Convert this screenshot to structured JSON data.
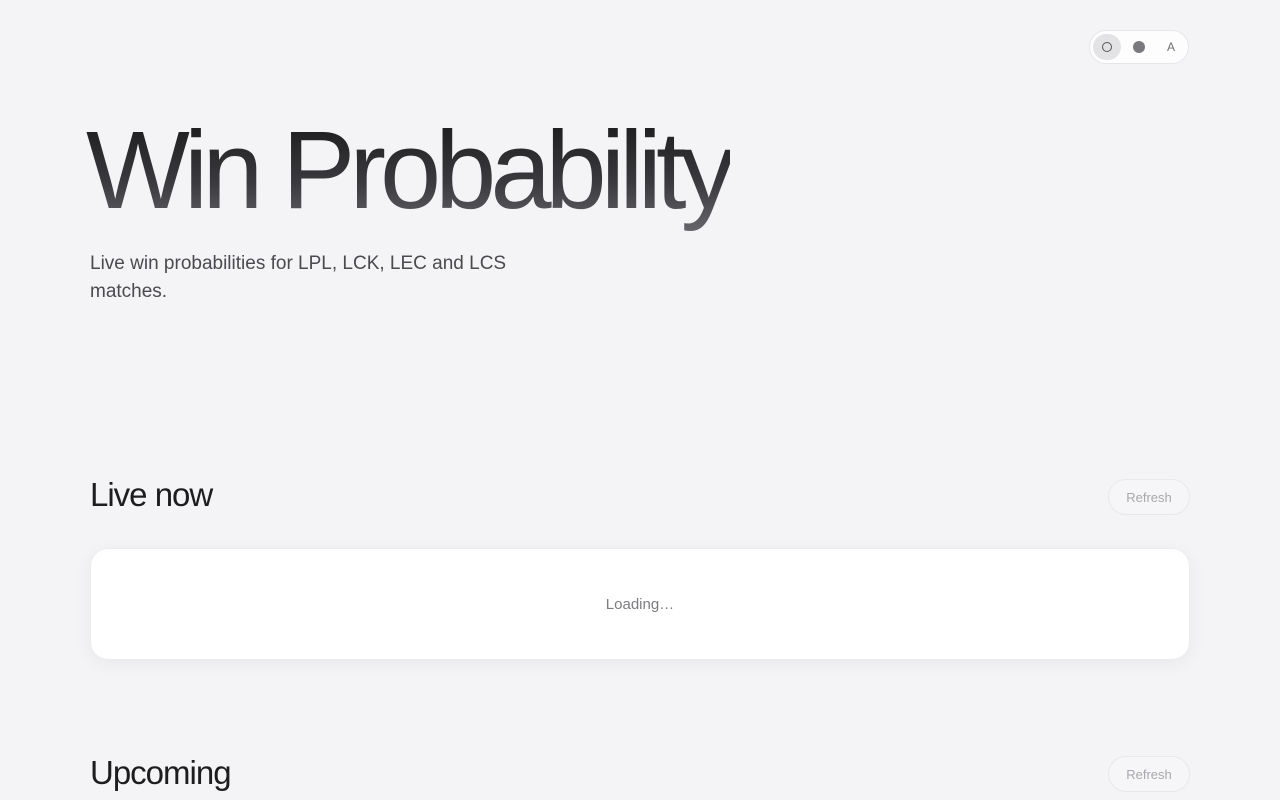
{
  "theme_toggle": {
    "options": [
      {
        "icon": "light-mode-icon",
        "active": true
      },
      {
        "icon": "dark-mode-icon",
        "active": false
      },
      {
        "icon": "auto-mode-icon",
        "label": "A",
        "active": false
      }
    ]
  },
  "hero": {
    "title": "Win Probability",
    "subtitle": "Live win probabilities for LPL, LCK, LEC and LCS matches."
  },
  "live_section": {
    "title": "Live now",
    "refresh_label": "Refresh",
    "status_text": "Loading…"
  },
  "upcoming_section": {
    "title": "Upcoming",
    "refresh_label": "Refresh"
  }
}
